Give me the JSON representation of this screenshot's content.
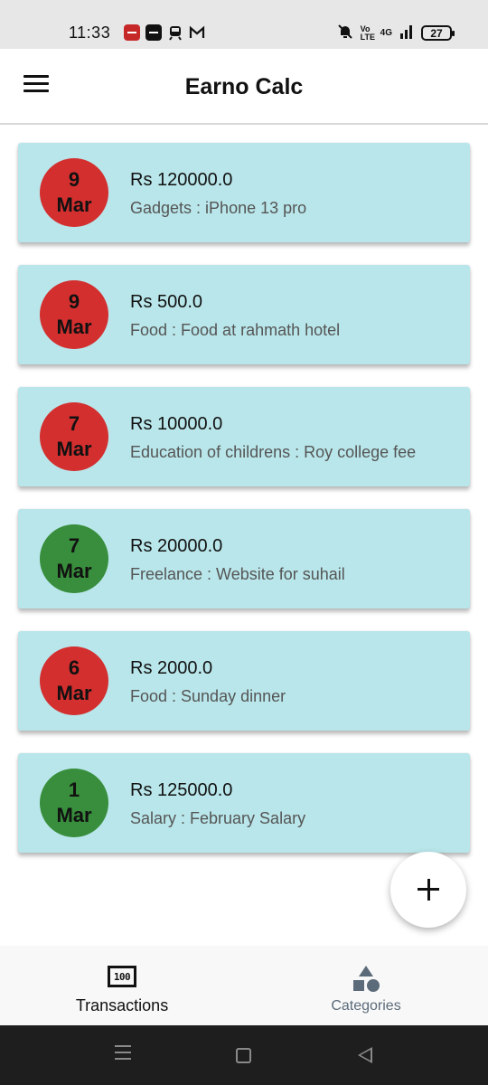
{
  "status_bar": {
    "time": "11:33",
    "network": "4G",
    "volte": "Vo LTE",
    "battery": "27",
    "icons": [
      "app-notification-icon",
      "app-notification-icon",
      "train-icon",
      "gmail-icon",
      "mute-icon",
      "signal-icon"
    ]
  },
  "app_bar": {
    "title": "Earno Calc",
    "menu_icon": "hamburger-menu-icon"
  },
  "colors": {
    "card_background": "#b9e6ea",
    "expense": "#d32f2f",
    "income": "#388e3c"
  },
  "transactions": [
    {
      "day": "9",
      "month": "Mar",
      "amount": "Rs 120000.0",
      "description": "Gadgets : iPhone 13 pro",
      "type": "expense",
      "color": "#d32f2f"
    },
    {
      "day": "9",
      "month": "Mar",
      "amount": "Rs 500.0",
      "description": "Food : Food at rahmath hotel",
      "type": "expense",
      "color": "#d32f2f"
    },
    {
      "day": "7",
      "month": "Mar",
      "amount": "Rs 10000.0",
      "description": "Education of childrens : Roy college fee",
      "type": "expense",
      "color": "#d32f2f"
    },
    {
      "day": "7",
      "month": "Mar",
      "amount": "Rs 20000.0",
      "description": "Freelance : Website for suhail",
      "type": "income",
      "color": "#388e3c"
    },
    {
      "day": "6",
      "month": "Mar",
      "amount": "Rs 2000.0",
      "description": "Food : Sunday dinner",
      "type": "expense",
      "color": "#d32f2f"
    },
    {
      "day": "1",
      "month": "Mar",
      "amount": "Rs 125000.0",
      "description": "Salary : February Salary",
      "type": "income",
      "color": "#388e3c"
    }
  ],
  "fab": {
    "icon": "plus-icon"
  },
  "bottom_nav": {
    "items": [
      {
        "label": "Transactions",
        "icon": "money-100-icon",
        "active": true
      },
      {
        "label": "Categories",
        "icon": "shapes-icon",
        "active": false
      }
    ]
  },
  "system_nav": {
    "buttons": [
      "recents-button",
      "home-button",
      "back-button"
    ]
  }
}
